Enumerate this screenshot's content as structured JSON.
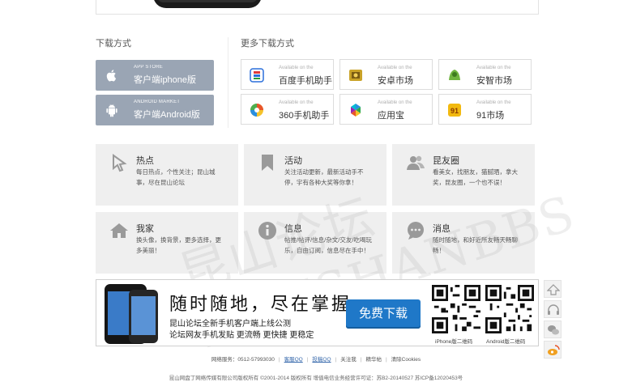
{
  "download": {
    "title": "下载方式",
    "buttons": [
      {
        "sub": "APP STORE",
        "label": "客户端iphone版",
        "icon": "apple-icon"
      },
      {
        "sub": "ANDROID MARKET",
        "label": "客户端Android版",
        "icon": "android-icon"
      }
    ]
  },
  "more": {
    "title": "更多下载方式",
    "stores": [
      {
        "sub": "Available on the",
        "name": "百度手机助手",
        "icon": "baidu-icon",
        "color": "#2a6fdb"
      },
      {
        "sub": "Available on the",
        "name": "安卓市场",
        "icon": "hiapk-icon",
        "color": "#c9a227"
      },
      {
        "sub": "Available on the",
        "name": "安智市场",
        "icon": "anzhi-icon",
        "color": "#6fb43f"
      },
      {
        "sub": "Available on the",
        "name": "360手机助手",
        "icon": "360-icon",
        "color": "#e8552a"
      },
      {
        "sub": "Available on the",
        "name": "应用宝",
        "icon": "yingyongbao-icon",
        "color": "#2aa94e"
      },
      {
        "sub": "Available on the",
        "name": "91市场",
        "icon": "91-icon",
        "color": "#f2b90f"
      }
    ]
  },
  "features": [
    {
      "title": "热点",
      "desc": "每日热点，个性关注；昆山城事，尽在昆山论坛",
      "icon": "cursor-icon"
    },
    {
      "title": "活动",
      "desc": "关注活动更新，最新活动手不停，宇有各种大奖等你拿！",
      "icon": "bookmark-icon"
    },
    {
      "title": "昆友圈",
      "desc": "看美女，找朋友，猫腻晒，拿大奖，昆友圈，一个也不误！",
      "icon": "friends-icon"
    },
    {
      "title": "我家",
      "desc": "换头像，换背景，更多选择，更多美丽！",
      "icon": "home-icon"
    },
    {
      "title": "信息",
      "desc": "帖推/帖评/信息/杂文/交友/吃喝玩乐，自由订阅，信息尽在手中！",
      "icon": "info-icon"
    },
    {
      "title": "消息",
      "desc": "随时随地，和好近所友畅天畅聊畅！",
      "icon": "message-icon"
    }
  ],
  "watermark": "昆山论坛 KUNSHANBBS",
  "banner": {
    "slogan": "随时随地，尽在掌握",
    "line1": "昆山论坛全新手机客户端上线公测",
    "line2": "论坛网友手机发贴 更流畅 更快捷 更稳定",
    "button": "免费下载",
    "qr1_label": "iPhone版二维码",
    "qr2_label": "Android版二维码"
  },
  "side_tools": [
    "top-arrow-icon",
    "headset-icon",
    "wechat-icon",
    "weibo-icon"
  ],
  "footer": {
    "hotline": "网络服务：0512-57993030",
    "links": [
      "客服QQ",
      "投稿QQ",
      "关注我",
      "精华帖",
      "清除Cookies"
    ],
    "copyright": "昆山网盘丁网络传媒有限公司版权所有 ©2001-2014 版权所有 增值电信业务经营许可证：苏B2-20140527 苏ICP备12020453号"
  }
}
